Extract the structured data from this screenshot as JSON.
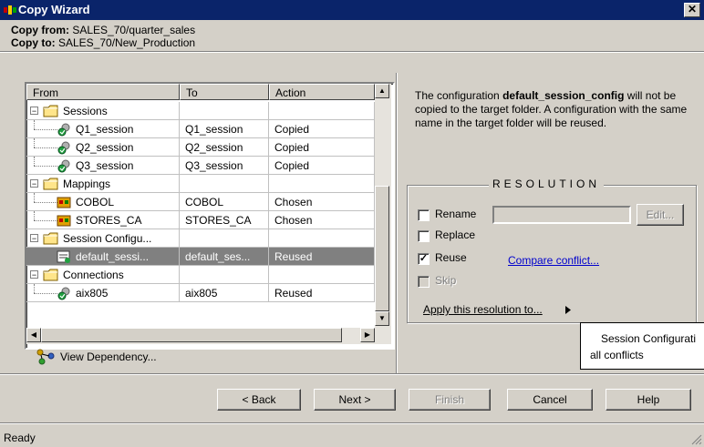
{
  "window": {
    "title": "Copy Wizard",
    "close_label": "✕"
  },
  "header": {
    "copy_from_label": "Copy from:",
    "copy_from_value": "SALES_70/quarter_sales",
    "copy_to_label": "Copy to:",
    "copy_to_value": "SALES_70/New_Production"
  },
  "table": {
    "columns": [
      "From",
      "To",
      "Action"
    ],
    "rows": [
      {
        "from": "Sessions",
        "to": "",
        "action": "",
        "type": "folder"
      },
      {
        "from": "Q1_session",
        "to": "Q1_session",
        "action": "Copied",
        "type": "session"
      },
      {
        "from": "Q2_session",
        "to": "Q2_session",
        "action": "Copied",
        "type": "session"
      },
      {
        "from": "Q3_session",
        "to": "Q3_session",
        "action": "Copied",
        "type": "session"
      },
      {
        "from": "Mappings",
        "to": "",
        "action": "",
        "type": "folder"
      },
      {
        "from": "COBOL",
        "to": "COBOL",
        "action": "Chosen",
        "type": "mapping"
      },
      {
        "from": "STORES_CA",
        "to": "STORES_CA",
        "action": "Chosen",
        "type": "mapping"
      },
      {
        "from": "Session Configu...",
        "to": "",
        "action": "",
        "type": "folder"
      },
      {
        "from": "default_sessi...",
        "to": "default_ses...",
        "action": "Reused",
        "type": "config",
        "selected": true
      },
      {
        "from": "Connections",
        "to": "",
        "action": "",
        "type": "folder"
      },
      {
        "from": "aix805",
        "to": "aix805",
        "action": "Reused",
        "type": "connection"
      }
    ]
  },
  "view_dependency_label": "View Dependency...",
  "description": {
    "pre": "The configuration ",
    "bold": "default_session_config",
    "post": " will not be copied to the target folder. A configuration with the same name in the target folder will be reused."
  },
  "resolution": {
    "title": "RESOLUTION",
    "rename_label": "Rename",
    "replace_label": "Replace",
    "reuse_label": "Reuse",
    "skip_label": "Skip",
    "edit_label": "Edit...",
    "compare_link": "Compare conflict...",
    "apply_label": "Apply this resolution to...",
    "reuse_checked": "✓",
    "popup_items": [
      "Session Configurati",
      "all conflicts"
    ]
  },
  "buttons": {
    "back": "< Back",
    "next": "Next >",
    "finish": "Finish",
    "cancel": "Cancel",
    "help": "Help"
  },
  "status": "Ready",
  "colors": {
    "title_bar": "#0a246a",
    "selection": "#808080",
    "link": "#0000cc"
  }
}
